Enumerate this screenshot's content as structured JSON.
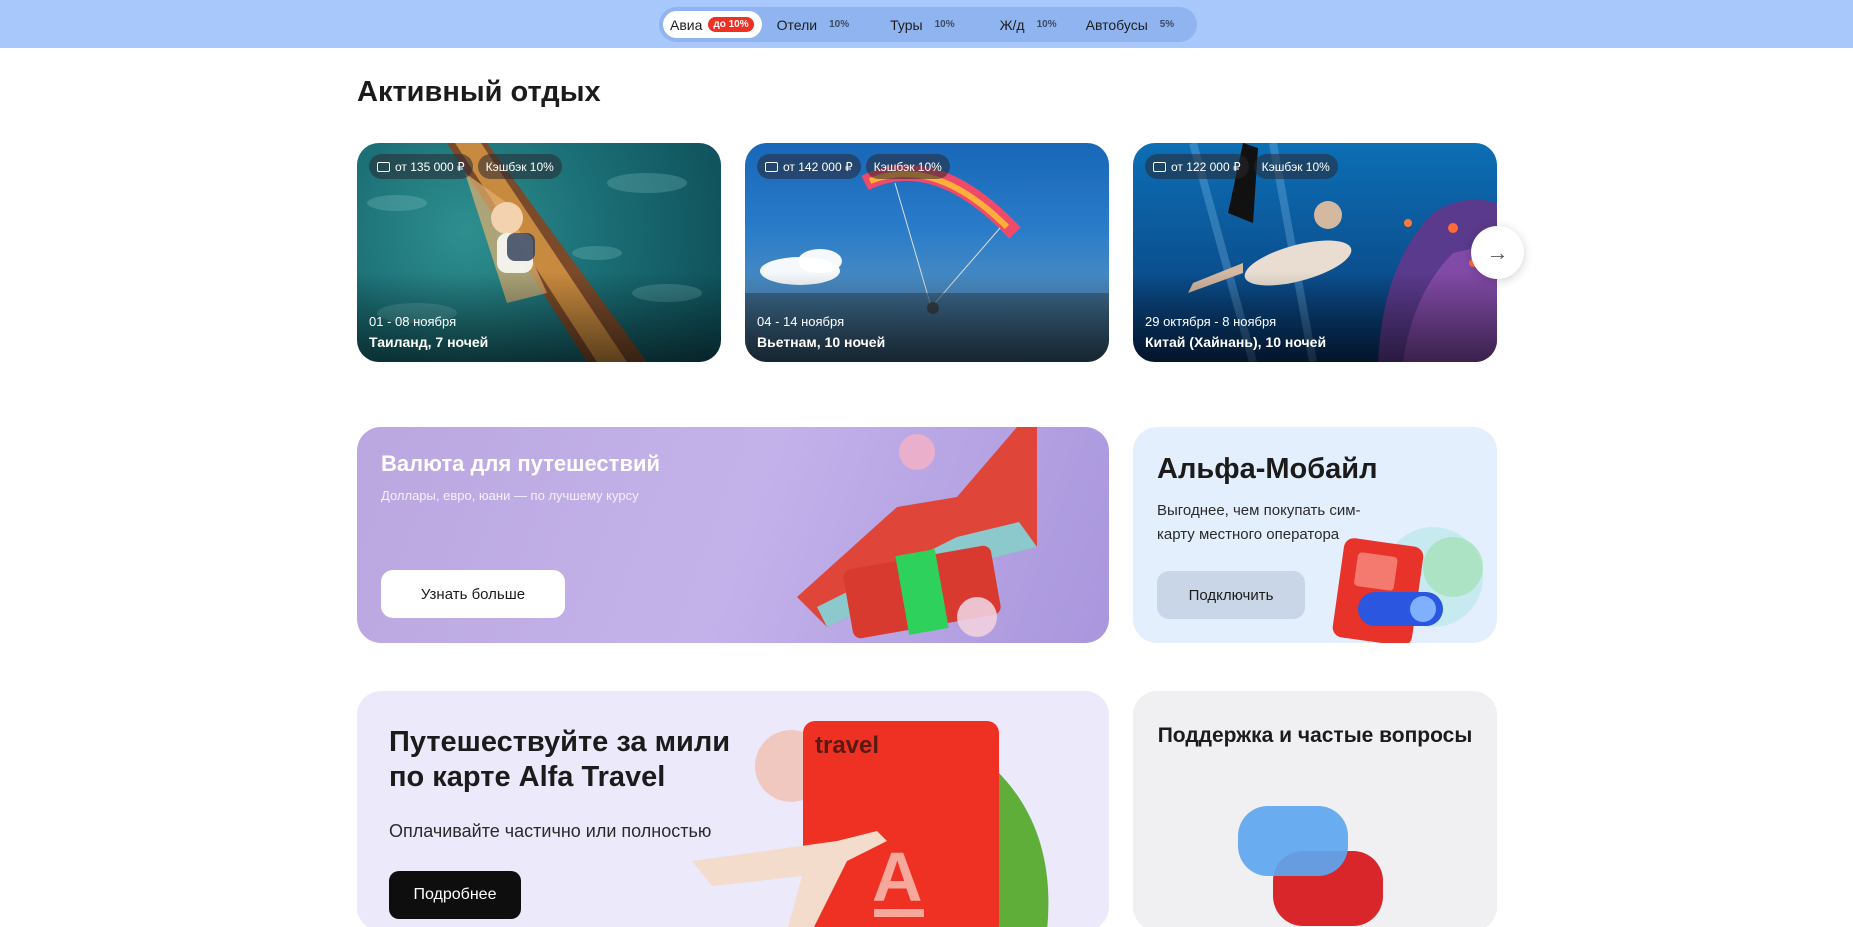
{
  "tabs": [
    {
      "label": "Авиа",
      "badge": "до 10%"
    },
    {
      "label": "Отели",
      "cashback": "10%"
    },
    {
      "label": "Туры",
      "cashback": "10%"
    },
    {
      "label": "Ж/д",
      "cashback": "10%"
    },
    {
      "label": "Автобусы",
      "cashback": "5%"
    }
  ],
  "section_title": "Активный отдых",
  "cards": [
    {
      "price": "от 135 000 ₽",
      "cashback": "Кэшбэк 10%",
      "dates": "01 - 08 ноября",
      "destination": "Таиланд, 7 ночей"
    },
    {
      "price": "от 142 000 ₽",
      "cashback": "Кэшбэк 10%",
      "dates": "04 - 14 ноября",
      "destination": "Вьетнам, 10 ночей"
    },
    {
      "price": "от 122 000 ₽",
      "cashback": "Кэшбэк 10%",
      "dates": "29 октября - 8 ноября",
      "destination": "Китай (Хайнань), 10 ночей"
    }
  ],
  "currency_banner": {
    "title": "Валюта для путешествий",
    "subtitle": "Доллары, евро, юани — по лучшему курсу",
    "button": "Узнать больше"
  },
  "mobile_banner": {
    "title": "Альфа-Мобайл",
    "subtitle": "Выгоднее, чем покупать сим-карту местного оператора",
    "button": "Подключить"
  },
  "travel_banner": {
    "title": "Путешествуйте за мили по карте Alfa Travel",
    "subtitle": "Оплачивайте частично или полностью",
    "button": "Подробнее",
    "card_brand": "travel"
  },
  "support_banner": {
    "title": "Поддержка и частые вопросы"
  }
}
